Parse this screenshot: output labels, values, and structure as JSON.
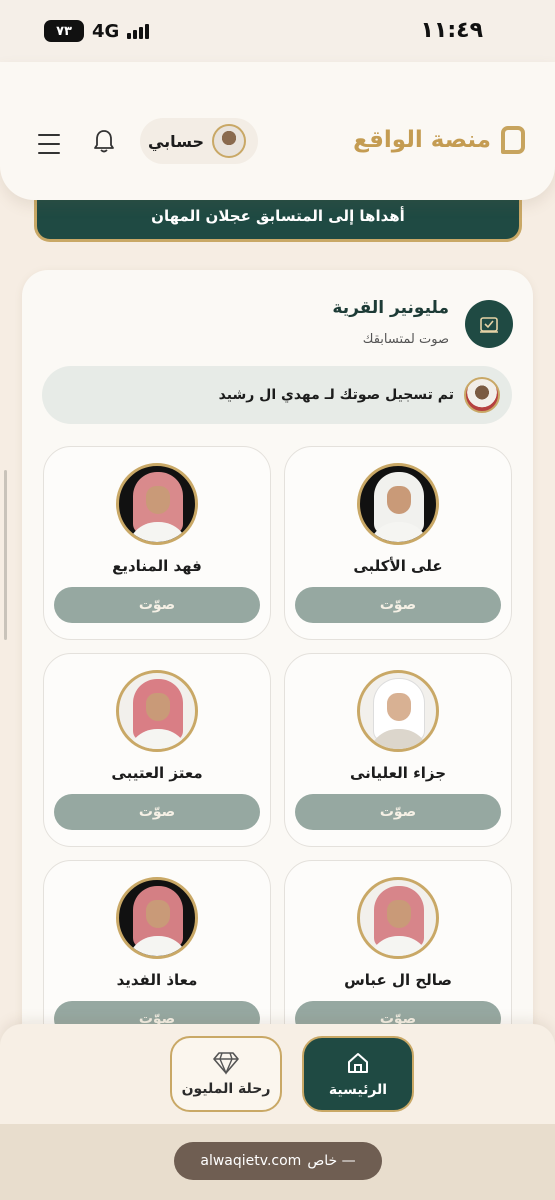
{
  "status_bar": {
    "time": "١١:٤٩",
    "network": "4G",
    "battery": "٧٣"
  },
  "header": {
    "brand": "منصة الواقع",
    "account_label": "حسابي"
  },
  "banner": {
    "text": "أهداها إلى المتسابق عجلان المهان"
  },
  "section": {
    "title": "مليونير القرية",
    "subtitle": "صوت لمتسابقك",
    "notice": "تم تسجيل صوتك لـ مهدي ال رشيد"
  },
  "contestants": [
    {
      "name": "على الأكلبى",
      "vote_label": "صوّت"
    },
    {
      "name": "فهد المناديع",
      "vote_label": "صوّت"
    },
    {
      "name": "جزاء العليانى",
      "vote_label": "صوّت"
    },
    {
      "name": "معتز العتيبى",
      "vote_label": "صوّت"
    },
    {
      "name": "صالح ال عباس",
      "vote_label": "صوّت"
    },
    {
      "name": "معاذ الفديد",
      "vote_label": "صوّت"
    }
  ],
  "bottom_nav": {
    "home": "الرئيسية",
    "journey": "رحلة المليون"
  },
  "browser": {
    "url": "alwaqietv.com",
    "tag": "خاص —"
  }
}
